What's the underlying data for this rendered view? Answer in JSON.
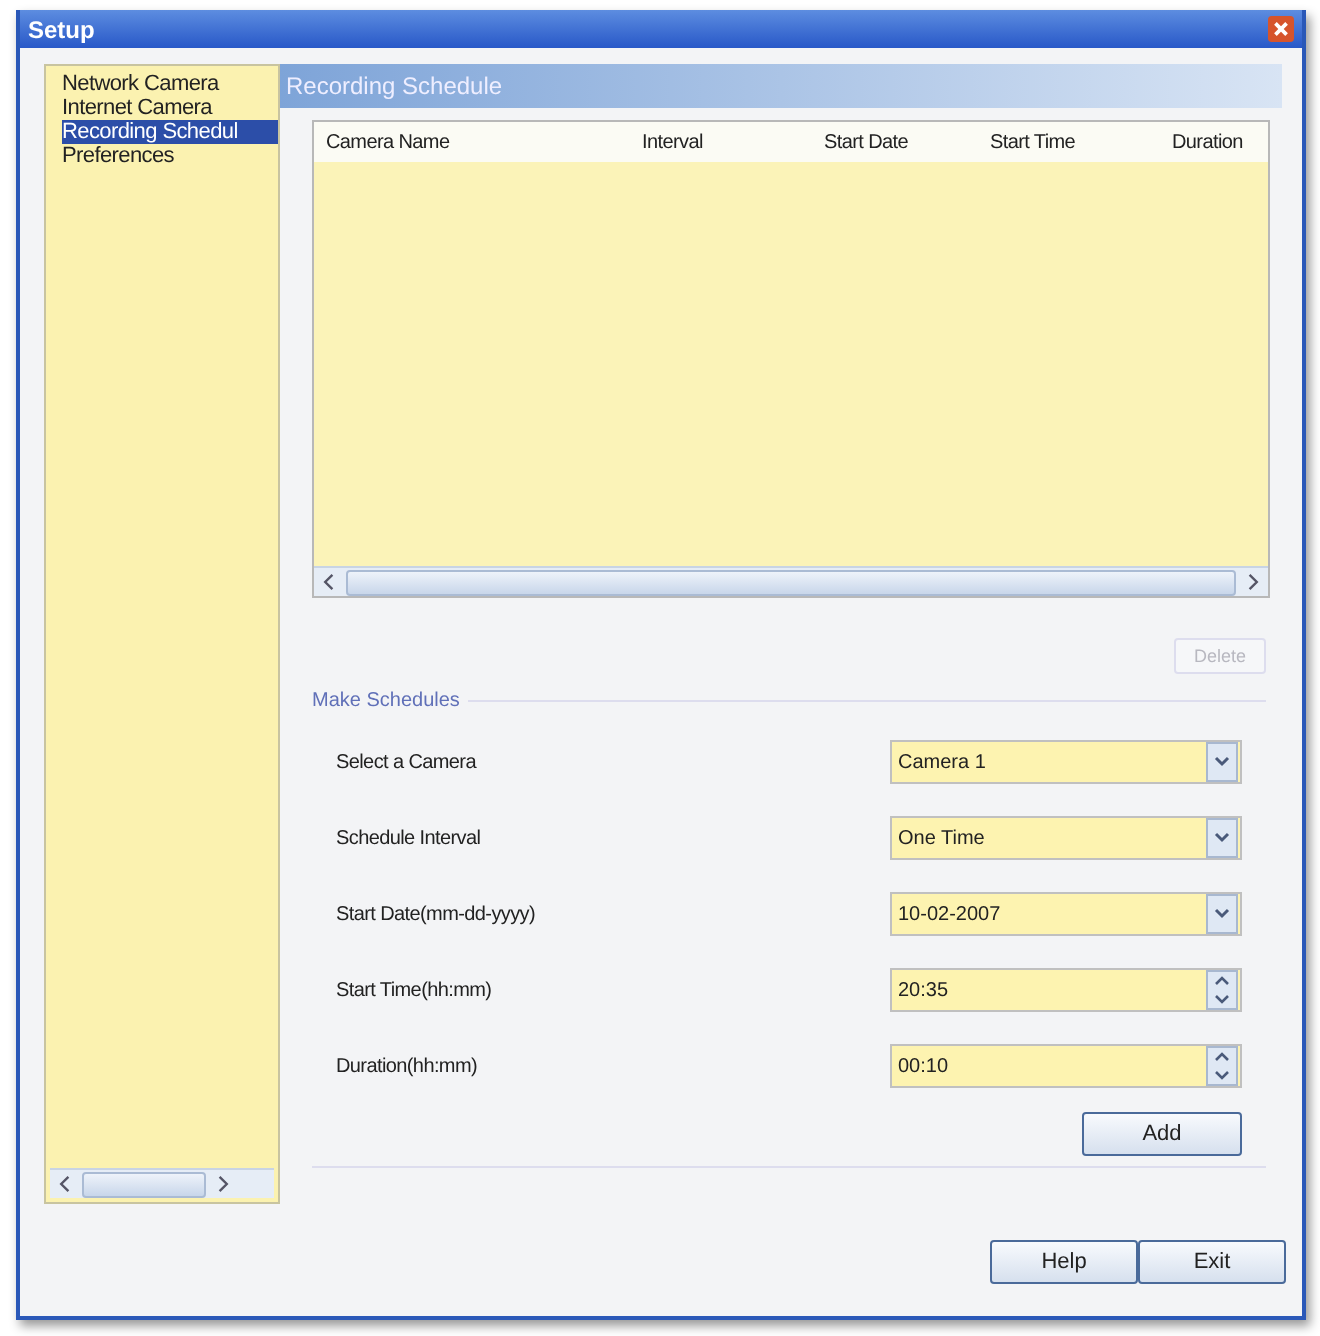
{
  "window": {
    "title": "Setup"
  },
  "sidebar": {
    "items": [
      {
        "label": "Network Camera",
        "selected": false
      },
      {
        "label": "Internet Camera",
        "selected": false
      },
      {
        "label": "Recording Schedul",
        "selected": true
      },
      {
        "label": "Preferences",
        "selected": false
      }
    ]
  },
  "panel": {
    "title": "Recording Schedule"
  },
  "table": {
    "columns": [
      "Camera Name",
      "Interval",
      "Start Date",
      "Start Time",
      "Duration"
    ]
  },
  "delete_button": {
    "label": "Delete",
    "disabled": true
  },
  "make_schedules": {
    "title": "Make Schedules",
    "fields": [
      {
        "label": "Select a Camera",
        "value": "Camera 1",
        "kind": "dropdown"
      },
      {
        "label": "Schedule Interval",
        "value": "One Time",
        "kind": "dropdown"
      },
      {
        "label": "Start Date(mm-dd-yyyy)",
        "value": "10-02-2007",
        "kind": "dropdown"
      },
      {
        "label": "Start Time(hh:mm)",
        "value": "20:35",
        "kind": "spinner"
      },
      {
        "label": "Duration(hh:mm)",
        "value": "00:10",
        "kind": "spinner"
      }
    ],
    "add_button": "Add"
  },
  "buttons": [
    "Help",
    "Exit"
  ]
}
